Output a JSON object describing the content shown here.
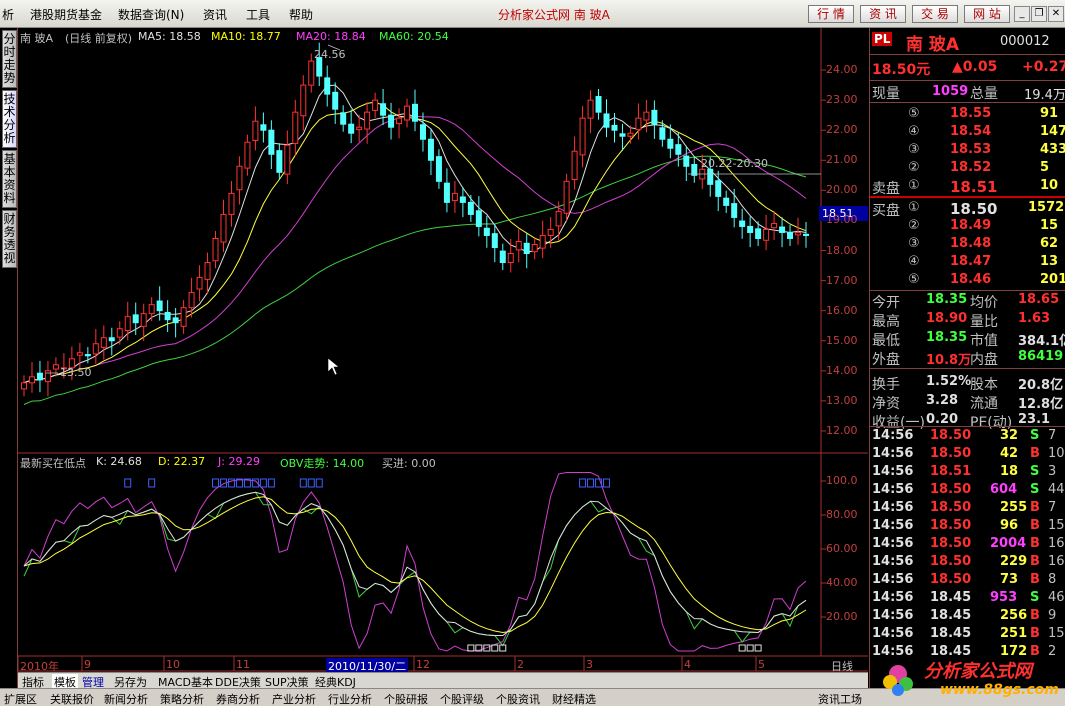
{
  "menubar": {
    "items": [
      "析",
      "港股期货基金",
      "数据查询(N)",
      "资讯",
      "工具",
      "帮助"
    ],
    "center_title": "分析家公式网 南 玻A",
    "buttons": [
      "行 情",
      "资 讯",
      "交 易",
      "网 站"
    ]
  },
  "side_tabs": [
    "分时走势",
    "技术分析",
    "基本资料",
    "财务透视"
  ],
  "chart": {
    "header": {
      "name": "南 玻A",
      "mode": "(日线 前复权)",
      "ma5": "MA5: 18.58",
      "ma10": "MA10: 18.77",
      "ma20": "MA20: 18.84",
      "ma60": "MA60: 20.54"
    },
    "price_axis": [
      "24.00",
      "23.00",
      "22.00",
      "21.00",
      "20.00",
      "19.00",
      "18.00",
      "17.00",
      "16.00",
      "15.00",
      "14.00",
      "13.00",
      "12.00"
    ],
    "current_price_label": "18.51",
    "annotations": {
      "high": "24.56",
      "low": "13.50",
      "mid": "20.22-20.30"
    },
    "indicator_header": {
      "name": "最新买在低点",
      "k": "K: 24.68",
      "d": "D: 22.37",
      "j": "J: 29.29",
      "obv": "OBV走势: 14.00",
      "buy": "买进: 0.00"
    },
    "indicator_axis": [
      "100.0",
      "80.00",
      "60.00",
      "40.00",
      "20.00"
    ],
    "date_axis": {
      "labels": [
        "2010年",
        "9",
        "10",
        "11",
        "12",
        "2",
        "3",
        "4",
        "5"
      ],
      "cursor": "2010/11/30/二",
      "period": "日线"
    }
  },
  "chart_data": {
    "type": "candlestick",
    "title": "南 玻A",
    "ylim": [
      11.5,
      24.8
    ],
    "closes": [
      13.6,
      13.8,
      13.7,
      14.0,
      14.2,
      14.1,
      14.4,
      14.6,
      14.5,
      14.9,
      15.1,
      15.0,
      15.4,
      15.8,
      15.6,
      15.9,
      16.2,
      16.0,
      15.7,
      15.6,
      16.1,
      16.6,
      17.1,
      17.6,
      18.4,
      19.2,
      19.9,
      20.8,
      21.6,
      22.3,
      22.0,
      21.2,
      20.6,
      21.5,
      22.6,
      23.5,
      24.3,
      23.8,
      23.2,
      22.7,
      22.2,
      21.9,
      22.1,
      22.6,
      23.0,
      22.5,
      22.1,
      22.4,
      22.8,
      22.3,
      21.7,
      21.0,
      20.3,
      19.6,
      19.9,
      19.6,
      19.2,
      18.8,
      18.5,
      18.1,
      17.6,
      17.9,
      18.3,
      17.9,
      18.2,
      18.5,
      18.7,
      19.3,
      20.3,
      21.3,
      22.4,
      23.0,
      22.6,
      22.1,
      22.0,
      21.8,
      21.9,
      22.4,
      22.6,
      22.2,
      21.7,
      21.4,
      21.2,
      20.8,
      20.5,
      20.7,
      20.2,
      19.8,
      19.5,
      19.1,
      18.8,
      18.6,
      18.4,
      18.7,
      18.9,
      18.6,
      18.4,
      18.6,
      18.5
    ]
  },
  "quote": {
    "title": "南 玻A",
    "code": "000012",
    "price": "18.50元",
    "change": "▲0.05",
    "change_pct": "+0.27",
    "now_vol_label": "现量",
    "now_vol": "1059",
    "total_vol_label": "总量",
    "total_vol": "19.4万",
    "sells": [
      {
        "n": "⑤",
        "p": "18.55",
        "v": "91"
      },
      {
        "n": "④",
        "p": "18.54",
        "v": "147"
      },
      {
        "n": "③",
        "p": "18.53",
        "v": "433"
      },
      {
        "n": "②",
        "p": "18.52",
        "v": "5"
      },
      {
        "n": "①",
        "p": "18.51",
        "v": "10"
      }
    ],
    "buys": [
      {
        "n": "①",
        "p": "18.50",
        "v": "1572"
      },
      {
        "n": "②",
        "p": "18.49",
        "v": "15"
      },
      {
        "n": "③",
        "p": "18.48",
        "v": "62"
      },
      {
        "n": "④",
        "p": "18.47",
        "v": "13"
      },
      {
        "n": "⑤",
        "p": "18.46",
        "v": "201"
      }
    ],
    "sell_label": "卖盘",
    "buy_label": "买盘",
    "stats": [
      [
        "今开",
        "18.35",
        "均价",
        "18.65"
      ],
      [
        "最高",
        "18.90",
        "量比",
        "1.63"
      ],
      [
        "最低",
        "18.35",
        "市值",
        "384.1亿"
      ],
      [
        "外盘",
        "10.8万",
        "内盘",
        "86419"
      ],
      [
        "换手",
        "1.52%",
        "股本",
        "20.8亿"
      ],
      [
        "净资",
        "3.28",
        "流通",
        "12.8亿"
      ],
      [
        "收益(一)",
        "0.20",
        "PE(动)",
        "23.1"
      ]
    ],
    "ticks": [
      [
        "14:56",
        "18.50",
        "32",
        "S",
        "7"
      ],
      [
        "14:56",
        "18.50",
        "42",
        "B",
        "10"
      ],
      [
        "14:56",
        "18.51",
        "18",
        "S",
        "3"
      ],
      [
        "14:56",
        "18.50",
        "604",
        "S",
        "44"
      ],
      [
        "14:56",
        "18.50",
        "255",
        "B",
        "7"
      ],
      [
        "14:56",
        "18.50",
        "96",
        "B",
        "15"
      ],
      [
        "14:56",
        "18.50",
        "2004",
        "B",
        "16"
      ],
      [
        "14:56",
        "18.50",
        "229",
        "B",
        "16"
      ],
      [
        "14:56",
        "18.50",
        "73",
        "B",
        "8"
      ],
      [
        "14:56",
        "18.45",
        "953",
        "S",
        "46"
      ],
      [
        "14:56",
        "18.45",
        "256",
        "B",
        "9"
      ],
      [
        "14:56",
        "18.45",
        "251",
        "B",
        "15"
      ],
      [
        "14:56",
        "18.45",
        "172",
        "B",
        "2"
      ]
    ]
  },
  "bottom_tabs": [
    "指标",
    "模板",
    "管理",
    "另存为",
    "MACD基本",
    "DDE决策",
    "SUP决策",
    "经典KDJ"
  ],
  "status_bar": [
    "扩展区",
    "关联报价",
    "新闻分析",
    "策略分析",
    "券商分析",
    "产业分析",
    "行业分析",
    "个股研报",
    "个股评级",
    "个股资讯",
    "财经精选",
    "资讯工场"
  ],
  "watermark": {
    "site": "分析家公式网",
    "url": "www.88gs.com"
  }
}
